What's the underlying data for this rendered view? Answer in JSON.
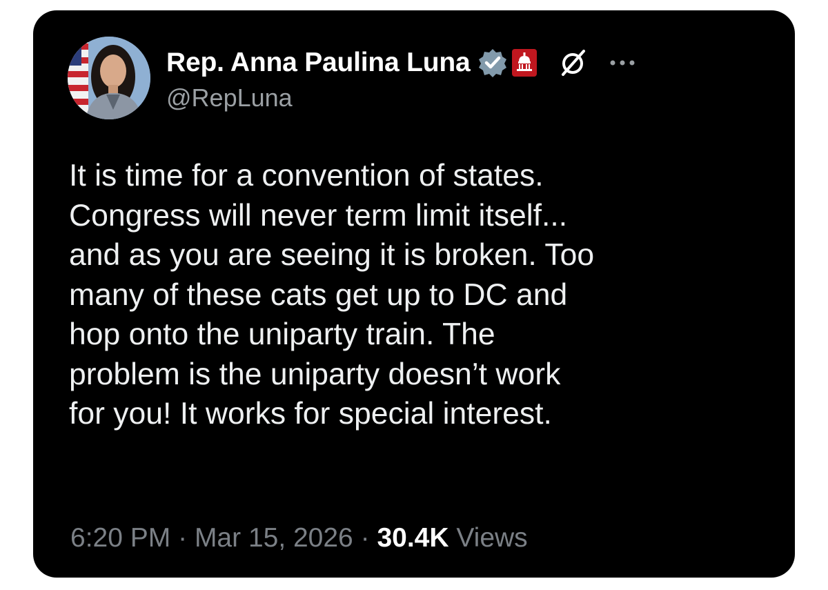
{
  "tweet": {
    "author": {
      "display_name": "Rep. Anna Paulina Luna",
      "handle": "@RepLuna",
      "verified_icon": "verified-badge-icon",
      "affiliation_icon": "us-capitol-icon"
    },
    "text": "It is time for a convention of states.\nCongress will never term limit itself...\nand as you are seeing it is broken. Too\nmany of these cats get up to DC and\nhop onto the uniparty train. The\nproblem is the uniparty doesn’t work\nfor you! It works for special interest.",
    "time": "6:20 PM",
    "separator": "·",
    "date": "Mar 15, 2026",
    "views_count": "30.4K",
    "views_label": "Views"
  },
  "icons": {
    "grok": "grok-icon",
    "more": "more-options-icon"
  },
  "colors": {
    "background": "#000000",
    "text": "#e7e9ea",
    "secondary_text": "#7b8086",
    "verified_badge": "#829aab",
    "affiliation_badge": "#c0171f"
  }
}
